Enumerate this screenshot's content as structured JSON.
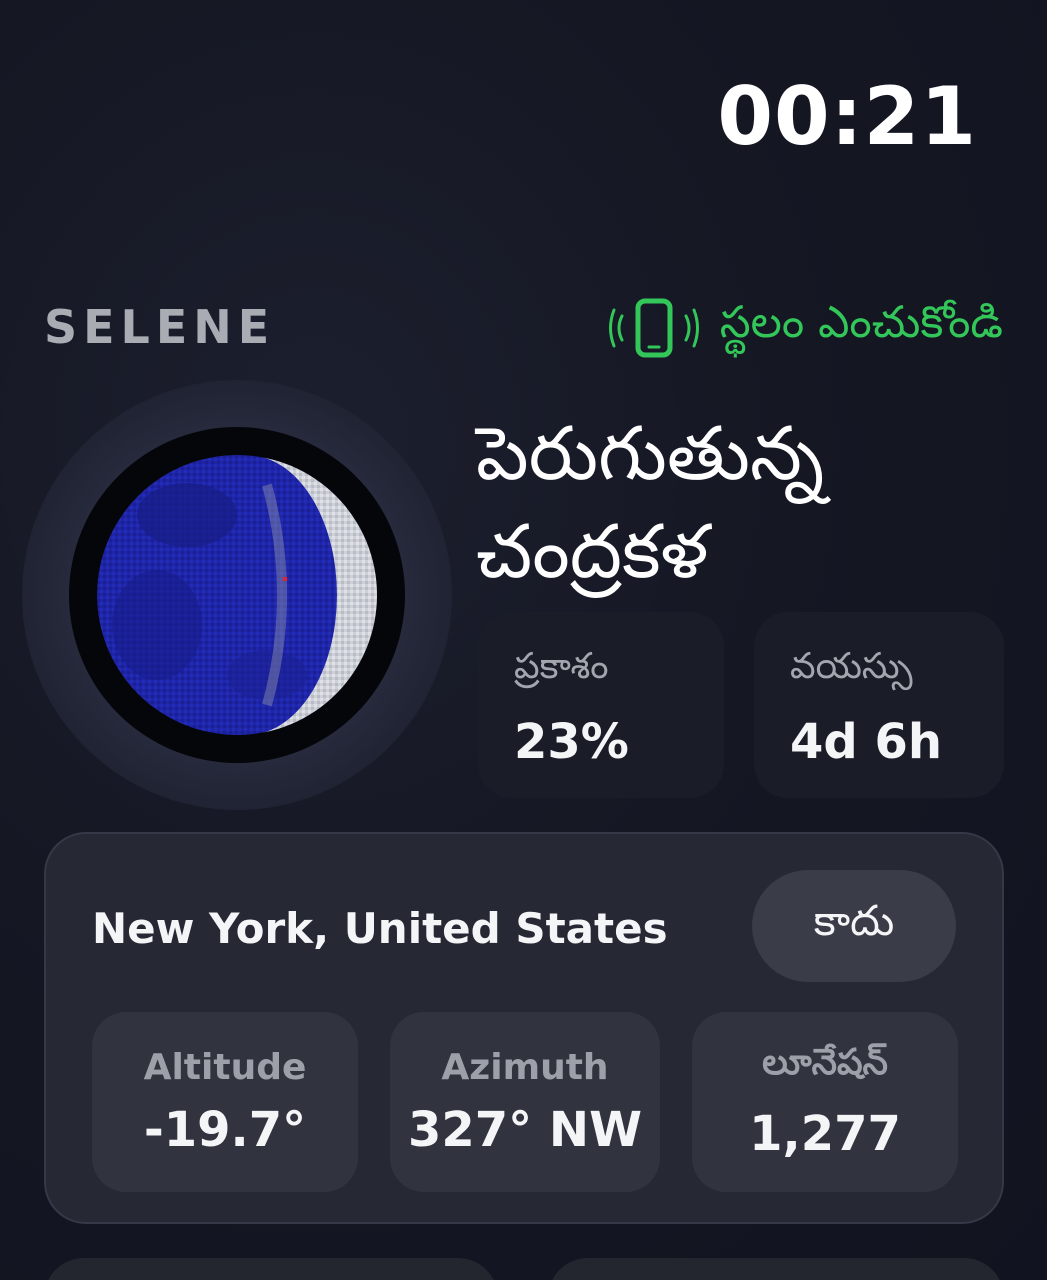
{
  "status_bar": {
    "time": "00:21"
  },
  "header": {
    "app_name": "SELENE",
    "location_button": {
      "icon": "phone-vibrate-icon",
      "label": "స్థలం ఎంచుకోండి",
      "color": "#33c759"
    }
  },
  "moon": {
    "phase_name": "పెరుగుతున్న చంద్రకళ",
    "illumination": {
      "label": "ప్రకాశం",
      "value": "23%"
    },
    "age": {
      "label": "వయస్సు",
      "value": "4d 6h"
    }
  },
  "location_card": {
    "place": "New York, United States",
    "dismiss_label": "కాదు",
    "stats": [
      {
        "label": "Altitude",
        "value": "-19.7°"
      },
      {
        "label": "Azimuth",
        "value": "327° NW"
      },
      {
        "label": "లూనేషన్",
        "value": "1,277"
      }
    ]
  }
}
